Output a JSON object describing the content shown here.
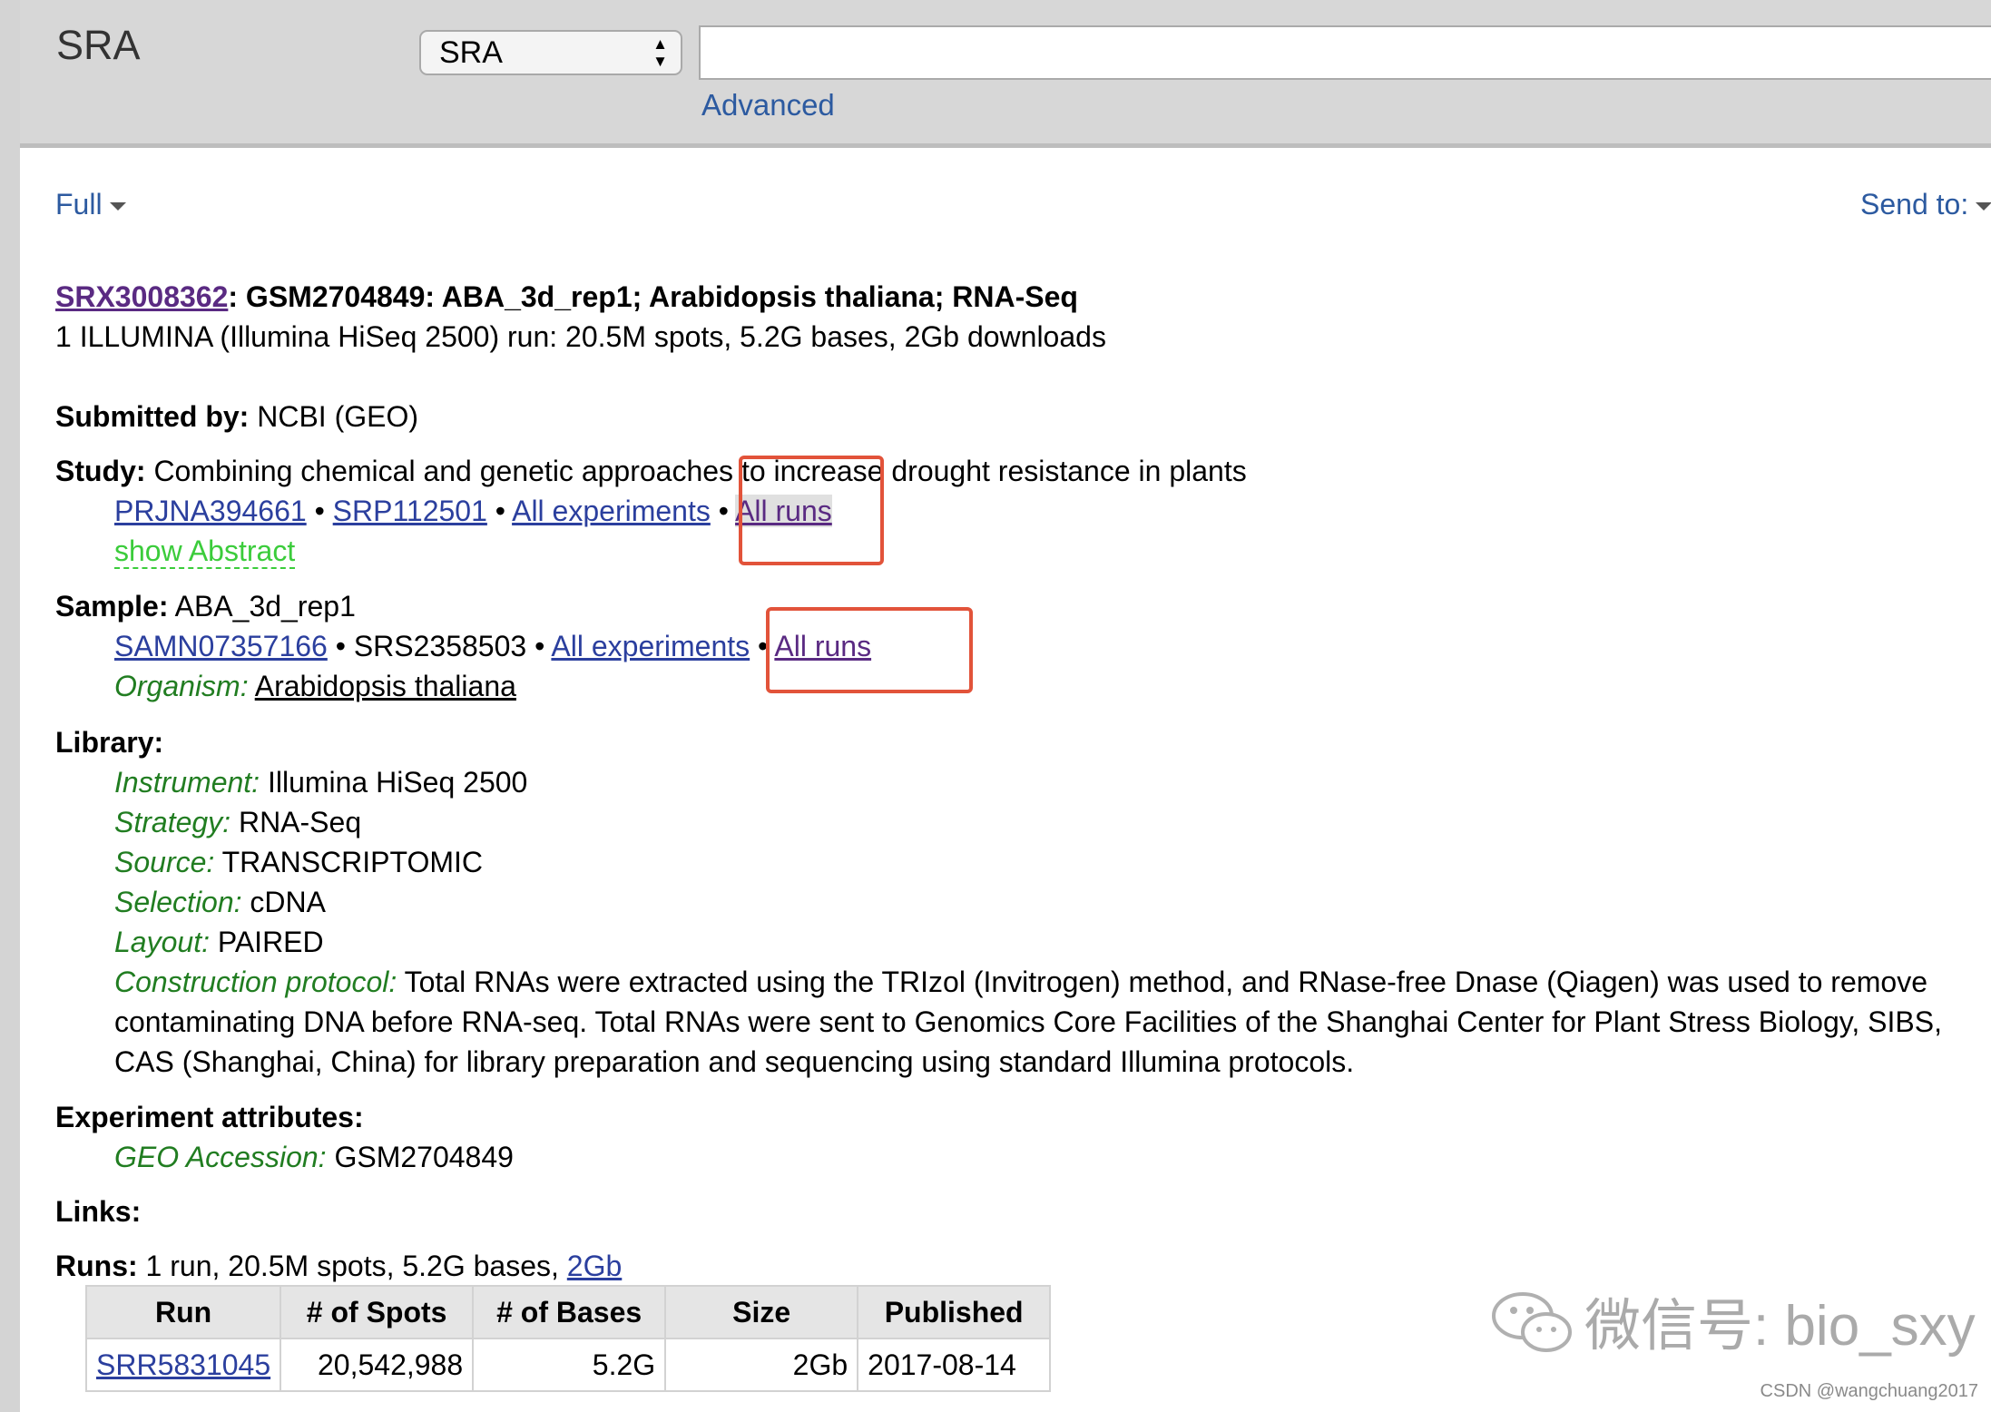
{
  "header": {
    "db_title": "SRA",
    "db_select": "SRA",
    "search_value": "",
    "advanced": "Advanced"
  },
  "toolbar": {
    "format": "Full",
    "send_to": "Send to:"
  },
  "record": {
    "accession": "SRX3008362",
    "title_rest": ": GSM2704849: ABA_3d_rep1; Arabidopsis thaliana; RNA-Seq",
    "summary": "1 ILLUMINA (Illumina HiSeq 2500) run: 20.5M spots, 5.2G bases, 2Gb downloads",
    "submitted_label": "Submitted by:",
    "submitted_value": "NCBI (GEO)",
    "study_label": "Study:",
    "study_value": "Combining chemical and genetic approaches to increase drought resistance in plants",
    "study_links": {
      "bioproject": "PRJNA394661",
      "srp": "SRP112501",
      "all_experiments": "All experiments",
      "all_runs": "All runs",
      "sep": "•"
    },
    "show_abstract": "show Abstract",
    "sample_label": "Sample:",
    "sample_value": "ABA_3d_rep1",
    "sample_links": {
      "biosample": "SAMN07357166",
      "srs": "SRS2358503",
      "all_experiments": "All experiments",
      "all_runs": "All runs",
      "sep": "•"
    },
    "organism_label": "Organism:",
    "organism_value": "Arabidopsis thaliana",
    "library_label": "Library:",
    "library": {
      "instrument_label": "Instrument:",
      "instrument": "Illumina HiSeq 2500",
      "strategy_label": "Strategy:",
      "strategy": "RNA-Seq",
      "source_label": "Source:",
      "source": "TRANSCRIPTOMIC",
      "selection_label": "Selection:",
      "selection": "cDNA",
      "layout_label": "Layout:",
      "layout": "PAIRED",
      "protocol_label": "Construction protocol:",
      "protocol_line1": "Total RNAs were extracted using the TRIzol (Invitrogen) method, and RNase-free Dnase (Qiagen) was used to remove",
      "protocol_line2": "contaminating DNA before RNA-seq. Total RNAs were sent to Genomics Core Facilities of the Shanghai Center for Plant Stress Biology, SIBS,",
      "protocol_line3": "CAS (Shanghai, China) for library preparation and sequencing using standard Illumina protocols."
    },
    "experiment_attributes_label": "Experiment attributes:",
    "geo_label": "GEO Accession:",
    "geo_value": "GSM2704849",
    "links_label": "Links:",
    "runs_label": "Runs:",
    "runs_summary": "1 run, 20.5M spots, 5.2G bases,",
    "runs_download": "2Gb"
  },
  "runs_table": {
    "headers": [
      "Run",
      "# of Spots",
      "# of Bases",
      "Size",
      "Published"
    ],
    "rows": [
      {
        "run": "SRR5831045",
        "spots": "20,542,988",
        "bases": "5.2G",
        "size": "2Gb",
        "published": "2017-08-14"
      }
    ]
  },
  "watermark": {
    "text": "微信号: bio_sxy",
    "credit": "CSDN @wangchuang2017"
  },
  "colors": {
    "annotation_box": "#e2533a",
    "label_green": "#217d21",
    "link_blue": "#2b3f9e",
    "visited_purple": "#5a2a82"
  }
}
